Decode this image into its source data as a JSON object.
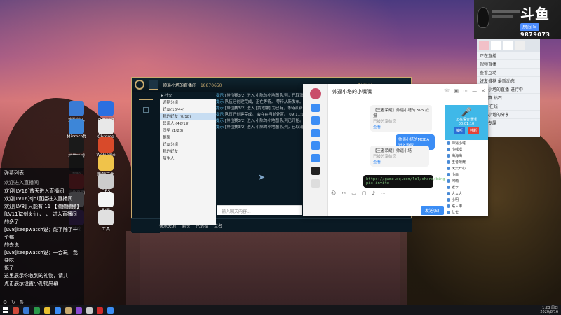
{
  "colors": {
    "accent": "#3b8df5",
    "lol_gold": "#c8aa6e",
    "chat_level": "#ffb84d",
    "douyu_blue": "#4c8dff"
  },
  "stream": {
    "brand": "斗鱼",
    "room_label": "房间号",
    "room_number": "9879073"
  },
  "danmaku": {
    "title": "弹幕列表",
    "subtitle": "欢迎进入直播间",
    "messages": [
      {
        "text": "欢迎[LV16]放天进入直播间"
      },
      {
        "text": "欢迎[LV16]sjdl直接进入直播间"
      },
      {
        "text": "欢迎[LV8] 只能有 11 【撤撤撤撤】"
      },
      {
        "text": "[LV11]Z剑炎仙 、 、 进入直播间"
      },
      {
        "text": "的多了"
      },
      {
        "text": "[LV8]keepwatch说：能了除了一个都"
      },
      {
        "text": "的去说"
      },
      {
        "text": "[LV8]keepwatch说：一会玩，我要吃"
      },
      {
        "text": "饭了"
      },
      {
        "text": "这里展示你收到的礼物，请共"
      },
      {
        "text": "点击展示设置小礼物屏幕"
      }
    ],
    "footer_icons": [
      "gear-icon",
      "refresh-icon",
      "sort-icon"
    ]
  },
  "lol": {
    "player_name": "帅逼小塔的直播间",
    "rp": "18870650",
    "status_top": "jfwr234",
    "log": [
      {
        "who": "提示",
        "text": "[排位赛3/2] 进入 小陈的小地图 队列，已取消 已有 09:11:09"
      },
      {
        "who": "提示",
        "text": "队伍已创建完成，正在等待。 等待从新发布。 09:11:09"
      },
      {
        "who": "提示",
        "text": "[排位赛3/2] 进入 [黄霞娜] 为已有，等待从新发布。 09:13:09"
      },
      {
        "who": "提示",
        "text": "队伍已创建完成。 会在在当前处置。 09:11:10"
      },
      {
        "who": "提示",
        "text": "[排位赛3/2] 进入 小陈的小地图 队列已开始。 09:11:11"
      },
      {
        "who": "提示",
        "text": "[排位赛3/2] 进入 小陈的小地图 队列，已取消。 09:11:13"
      }
    ],
    "bottom_items": [
      "快乐天地",
      "愉悦",
      "已选择",
      "点名"
    ],
    "search_placeholder": "输入聊天内容..."
  },
  "qq_list": {
    "rows": [
      "近期分组",
      "好友(16/44)",
      "我的好友 (0/18)",
      "联系人 (42/18)",
      "同学 (1/28)",
      "群聊",
      "好友分组",
      "我的好友",
      "陌生人"
    ]
  },
  "qq": {
    "contact_title": "帅逼小塔的小嘿嘿",
    "messages": [
      {
        "side": "left",
        "text": "【王者荣耀】帅逼小塔的 5v5 战报",
        "sub": "已被分享给您",
        "link": "查看"
      },
      {
        "side": "right",
        "text": "帅逼小塔的MOBA进入游戏"
      },
      {
        "side": "left",
        "text": "【王者荣耀】帅逼小塔",
        "sub": "已被分享给您",
        "link": "查看"
      }
    ],
    "code_text": "https://game.qq.com/lol/share/bingo-pic-invite",
    "send_label": "发送(S)",
    "toolbar": [
      "emoji-icon",
      "scissors-icon",
      "folder-icon",
      "image-icon",
      "mic-icon",
      "more-icon"
    ]
  },
  "blue_card": {
    "title": "正在语音通话",
    "time": "00:01:10",
    "btn_accept": "接听",
    "btn_hangup": "挂断"
  },
  "contacts": [
    "帅逼小塔",
    "小嘿嘿",
    "海海海",
    "王者荣耀",
    "天天开心",
    "小白",
    "阿萌",
    "老李",
    "大大大",
    "小明",
    "路人甲",
    "队长"
  ],
  "friend_panel": {
    "rows": [
      "正在直播",
      "视频直播",
      "查看互动",
      "好友推荐 最新动态",
      "帅逼小塔的直播 进行中",
      "排位赛 钻石",
      "最近 在线",
      "帅逼小塔的分享",
      "斗鱼专属"
    ]
  },
  "desktop_icons": [
    {
      "label": "搜狗输入",
      "color": "#3a7bd5",
      "icon": "sogou-icon"
    },
    {
      "label": "百度网盘",
      "color": "#2b6fe0",
      "icon": "baidu-netdisk-icon"
    },
    {
      "label": "Microsoft",
      "color": "#3d86d8",
      "icon": "edge-icon"
    },
    {
      "label": "Chrome",
      "color": "#e8e8e8",
      "icon": "chrome-icon"
    },
    {
      "label": "英雄联盟",
      "color": "#1a1a1a",
      "icon": "lol-icon"
    },
    {
      "label": "WeGame",
      "color": "#d84a2a",
      "icon": "wegame-icon"
    },
    {
      "label": "剪映",
      "color": "#141414",
      "icon": "jianying-icon"
    },
    {
      "label": "新建文件",
      "color": "#f0c34a",
      "icon": "folder-icon"
    },
    {
      "label": "斗鱼直播",
      "color": "#d02a2a",
      "icon": "douyu-icon"
    },
    {
      "label": "OBS",
      "color": "#ccc",
      "icon": "obs-icon"
    },
    {
      "label": "文档",
      "color": "#f5f5f5",
      "icon": "doc-icon"
    },
    {
      "label": "配置",
      "color": "#f5f5f5",
      "icon": "doc-icon"
    },
    {
      "label": "游戏",
      "color": "#603090",
      "icon": "game-icon"
    },
    {
      "label": "工具",
      "color": "#e0e0e0",
      "icon": "tool-icon"
    }
  ],
  "taskbar": {
    "time": "1:23 周日",
    "date": "2020/8/16"
  }
}
